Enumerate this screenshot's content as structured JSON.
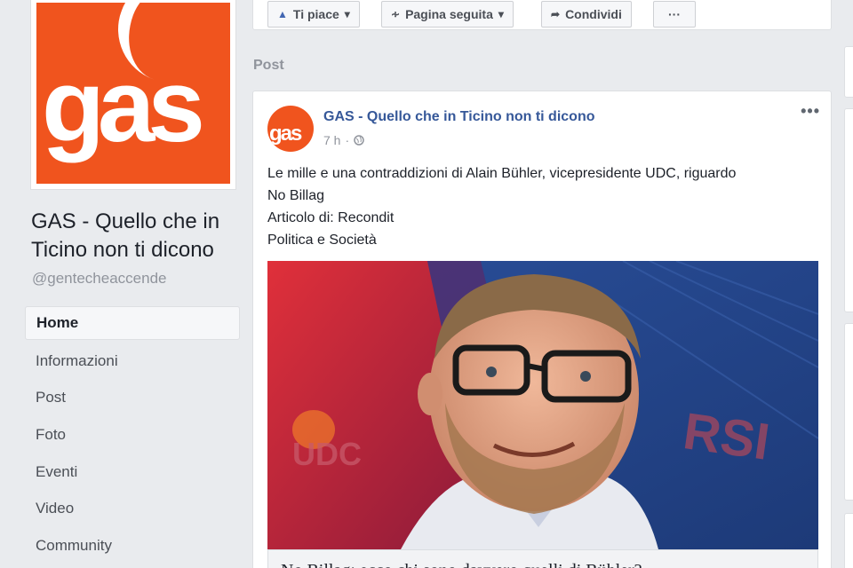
{
  "page": {
    "logo_text": "gas",
    "name": "GAS - Quello che in Ticino non ti dicono",
    "handle": "@gentecheaccende"
  },
  "sidebar": {
    "items": [
      {
        "label": "Home",
        "active": true
      },
      {
        "label": "Informazioni"
      },
      {
        "label": "Post"
      },
      {
        "label": "Foto"
      },
      {
        "label": "Eventi"
      },
      {
        "label": "Video"
      },
      {
        "label": "Community"
      }
    ]
  },
  "action_bar": {
    "like_label": "Ti piace",
    "follow_label": "Pagina seguita",
    "share_label": "Condividi",
    "more_label": "···"
  },
  "section": {
    "label": "Post"
  },
  "post": {
    "avatar_text": "gas",
    "author": "GAS - Quello che in Ticino non ti dicono",
    "time": "7 h",
    "more_label": "•••",
    "text_lines": [
      "Le mille e una contraddizioni di Alain Bühler, vicepresidente UDC, riguardo",
      "No Billag",
      "Articolo di: Recondit",
      "Politica e Società"
    ],
    "image_badges": {
      "left": "UDC",
      "right": "RSI"
    },
    "link_title": "No Billag: ecco chi sono davvero quelli di Bühler?"
  },
  "colors": {
    "brand_orange": "#f0541e",
    "link_blue": "#365899",
    "page_bg": "#e9ebee"
  }
}
